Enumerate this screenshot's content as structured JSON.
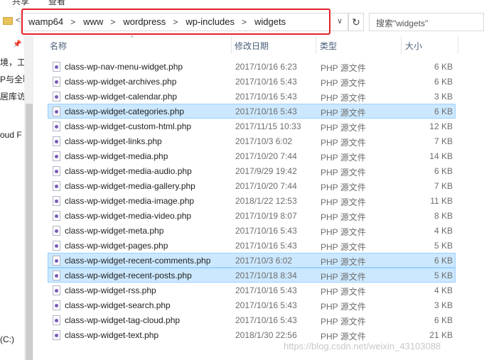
{
  "ribbon": {
    "tabs": [
      "共享",
      "查看"
    ]
  },
  "address": {
    "crumbs": [
      "wamp64",
      "www",
      "wordpress",
      "wp-includes",
      "widgets"
    ],
    "back_glyph": "<",
    "dropdown_glyph": "∨",
    "refresh_glyph": "↻"
  },
  "search": {
    "placeholder": "搜索\"widgets\""
  },
  "nav": {
    "items": [
      "境，工具",
      "P与全职",
      "居库访问",
      "oud F",
      "(C:)"
    ]
  },
  "columns": {
    "name": "名称",
    "modified": "修改日期",
    "type": "类型",
    "size": "大小"
  },
  "files": [
    {
      "name": "class-wp-nav-menu-widget.php",
      "modified": "2017/10/16 6:23",
      "type": "PHP 源文件",
      "size": "6 KB",
      "selected": false
    },
    {
      "name": "class-wp-widget-archives.php",
      "modified": "2017/10/16 5:43",
      "type": "PHP 源文件",
      "size": "6 KB",
      "selected": false
    },
    {
      "name": "class-wp-widget-calendar.php",
      "modified": "2017/10/16 5:43",
      "type": "PHP 源文件",
      "size": "3 KB",
      "selected": false
    },
    {
      "name": "class-wp-widget-categories.php",
      "modified": "2017/10/16 5:43",
      "type": "PHP 源文件",
      "size": "6 KB",
      "selected": true
    },
    {
      "name": "class-wp-widget-custom-html.php",
      "modified": "2017/11/15 10:33",
      "type": "PHP 源文件",
      "size": "12 KB",
      "selected": false
    },
    {
      "name": "class-wp-widget-links.php",
      "modified": "2017/10/3 6:02",
      "type": "PHP 源文件",
      "size": "7 KB",
      "selected": false
    },
    {
      "name": "class-wp-widget-media.php",
      "modified": "2017/10/20 7:44",
      "type": "PHP 源文件",
      "size": "14 KB",
      "selected": false
    },
    {
      "name": "class-wp-widget-media-audio.php",
      "modified": "2017/9/29 19:42",
      "type": "PHP 源文件",
      "size": "6 KB",
      "selected": false
    },
    {
      "name": "class-wp-widget-media-gallery.php",
      "modified": "2017/10/20 7:44",
      "type": "PHP 源文件",
      "size": "7 KB",
      "selected": false
    },
    {
      "name": "class-wp-widget-media-image.php",
      "modified": "2018/1/22 12:53",
      "type": "PHP 源文件",
      "size": "11 KB",
      "selected": false
    },
    {
      "name": "class-wp-widget-media-video.php",
      "modified": "2017/10/19 8:07",
      "type": "PHP 源文件",
      "size": "8 KB",
      "selected": false
    },
    {
      "name": "class-wp-widget-meta.php",
      "modified": "2017/10/16 5:43",
      "type": "PHP 源文件",
      "size": "4 KB",
      "selected": false
    },
    {
      "name": "class-wp-widget-pages.php",
      "modified": "2017/10/16 5:43",
      "type": "PHP 源文件",
      "size": "5 KB",
      "selected": false
    },
    {
      "name": "class-wp-widget-recent-comments.php",
      "modified": "2017/10/3 6:02",
      "type": "PHP 源文件",
      "size": "6 KB",
      "selected": true
    },
    {
      "name": "class-wp-widget-recent-posts.php",
      "modified": "2017/10/18 8:34",
      "type": "PHP 源文件",
      "size": "5 KB",
      "selected": true
    },
    {
      "name": "class-wp-widget-rss.php",
      "modified": "2017/10/16 5:43",
      "type": "PHP 源文件",
      "size": "4 KB",
      "selected": false
    },
    {
      "name": "class-wp-widget-search.php",
      "modified": "2017/10/16 5:43",
      "type": "PHP 源文件",
      "size": "3 KB",
      "selected": false
    },
    {
      "name": "class-wp-widget-tag-cloud.php",
      "modified": "2017/10/16 5:43",
      "type": "PHP 源文件",
      "size": "6 KB",
      "selected": false
    },
    {
      "name": "class-wp-widget-text.php",
      "modified": "2018/1/30 22:56",
      "type": "PHP 源文件",
      "size": "21 KB",
      "selected": false
    }
  ],
  "watermark": "https://blog.csdn.net/weixin_43103088",
  "colors": {
    "selection": "#cce8ff",
    "selection_border": "#99d1ff",
    "highlight_box": "#e3222a",
    "header_text": "#4c607a"
  }
}
